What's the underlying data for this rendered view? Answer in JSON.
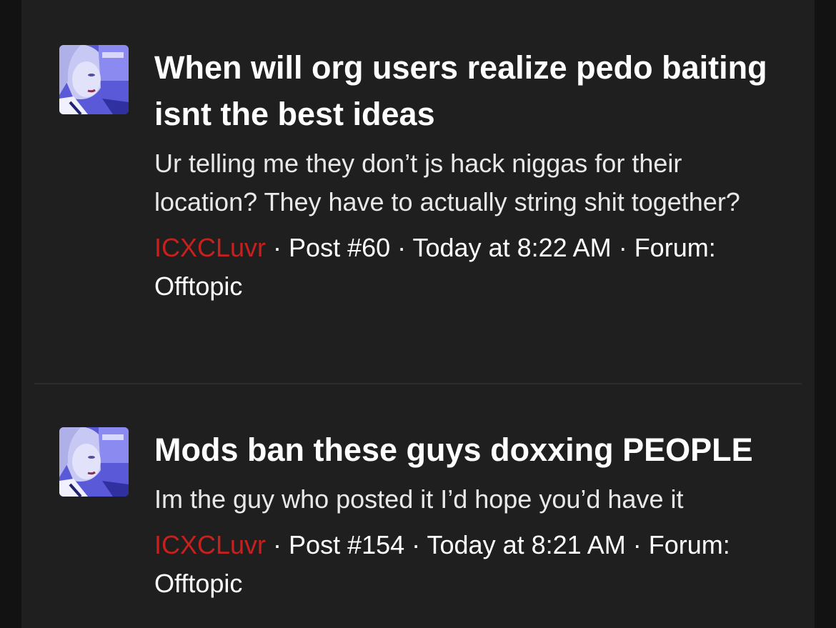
{
  "results": [
    {
      "title": "When will org users realize pedo baiting isnt the best ideas",
      "snippet": "Ur telling me they don’t js hack niggas for their location? They have to actually string shit together?",
      "author": "ICXCLuvr",
      "sep1": " · ",
      "post": "Post #60",
      "sep2": " · ",
      "time": "Today at 8:22 AM",
      "sep3": " · ",
      "forum_label": "Forum:",
      "forum": "Offtopic"
    },
    {
      "title": "Mods ban these guys doxxing PEOPLE",
      "snippet": "Im the guy who posted it I’d hope you’d have it",
      "author": "ICXCLuvr",
      "sep1": " · ",
      "post": "Post #154",
      "sep2": " · ",
      "time": "Today at 8:21 AM",
      "sep3": " · ",
      "forum_label": "Forum:",
      "forum": "Offtopic"
    }
  ],
  "colors": {
    "background": "#1f1f20",
    "author": "#c8201c",
    "text": "#ffffff",
    "avatar_tint": "#4a4ad0"
  },
  "icons": {
    "avatar": "user-avatar-photo"
  }
}
